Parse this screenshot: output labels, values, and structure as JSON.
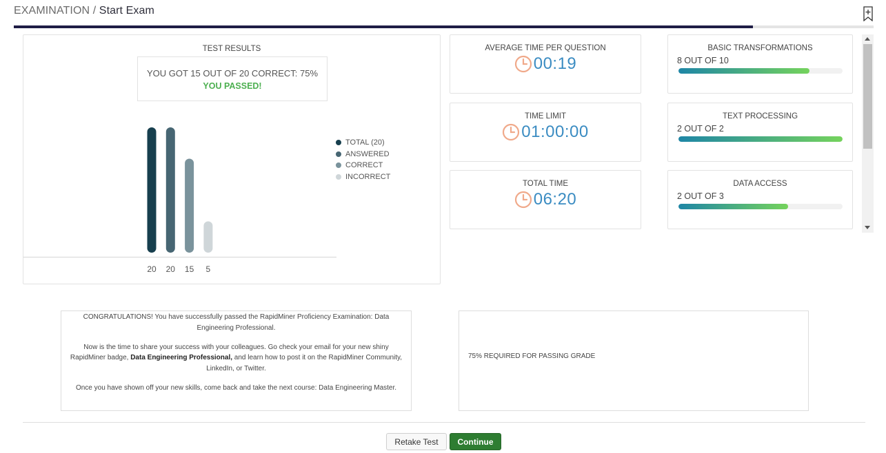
{
  "header": {
    "breadcrumb_section": "EXAMINATION",
    "breadcrumb_separator": "/",
    "breadcrumb_current": "Start Exam",
    "progress_fraction": 0.86
  },
  "results": {
    "title": "TEST RESULTS",
    "score_text": "YOU GOT 15 OUT OF 20 CORRECT: 75%",
    "passed_text": "YOU PASSED!",
    "legend": [
      "TOTAL (20)",
      "ANSWERED",
      "CORRECT",
      "INCORRECT"
    ]
  },
  "chart_data": {
    "type": "bar",
    "categories": [
      "TOTAL (20)",
      "ANSWERED",
      "CORRECT",
      "INCORRECT"
    ],
    "values": [
      20,
      20,
      15,
      5
    ],
    "value_labels": [
      "20",
      "20",
      "15",
      "5"
    ],
    "colors": [
      "#173f4e",
      "#476673",
      "#7a939c",
      "#cfd6d9"
    ],
    "ylim": [
      0,
      20
    ],
    "legend_position": "right",
    "grid": false
  },
  "stats": [
    {
      "title": "AVERAGE TIME PER QUESTION",
      "value": "00:19"
    },
    {
      "title": "TIME LIMIT",
      "value": "01:00:00"
    },
    {
      "title": "TOTAL TIME",
      "value": "06:20"
    }
  ],
  "topics": [
    {
      "title": "BASIC TRANSFORMATIONS",
      "score": "8 OUT OF 10",
      "fraction": 0.8
    },
    {
      "title": "TEXT PROCESSING",
      "score": "2 OUT OF 2",
      "fraction": 1.0
    },
    {
      "title": "DATA ACCESS",
      "score": "2 OUT OF 3",
      "fraction": 0.667
    }
  ],
  "message": {
    "p1": "CONGRATULATIONS! You have successfully passed the RapidMiner Proficiency Examination: Data Engineering Professional.",
    "p2_before": "Now is the time to share your success with your colleagues. Go check your email for your new shiny RapidMiner badge, ",
    "p2_bold": "Data Engineering Professional,",
    "p2_after": " and learn how to post it on the RapidMiner Community, LinkedIn, or Twitter.",
    "p3": "Once you have shown off your new skills, come back and take the next course: Data Engineering Master."
  },
  "requirement_text": "75% REQUIRED FOR PASSING GRADE",
  "buttons": {
    "retake": "Retake Test",
    "continue": "Continue"
  },
  "colors": {
    "accent": "#1f1d45",
    "clock": "#f0a98a",
    "time_text": "#3b8cc2",
    "pass_green": "#4caf50",
    "continue_bg": "#2e7d32"
  },
  "icons": {
    "clock": "clock-icon",
    "bookmark": "bookmark-add-icon"
  }
}
